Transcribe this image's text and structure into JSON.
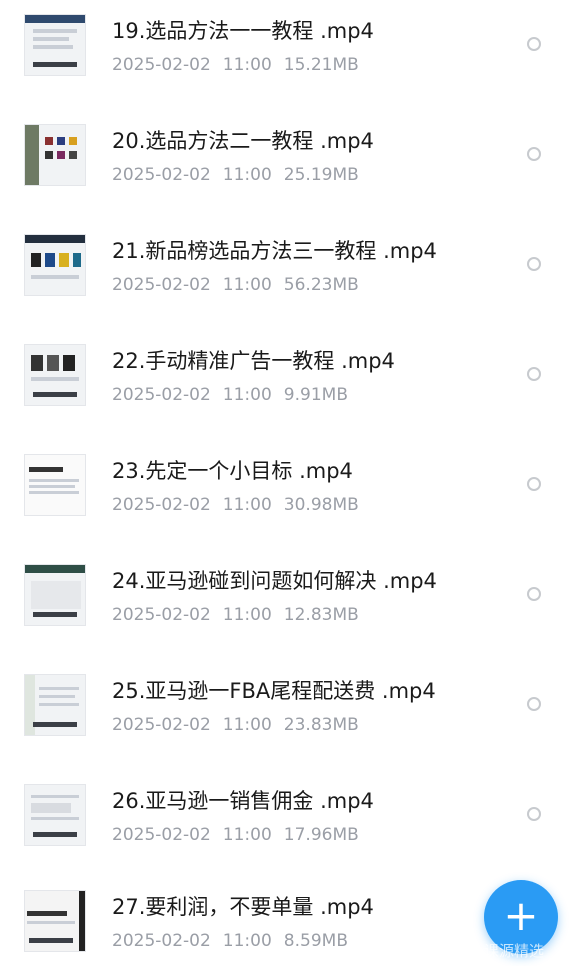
{
  "colors": {
    "accent": "#2a9bf4",
    "title_text": "#1a1a1a",
    "meta_text": "#9a9ea6"
  },
  "files": [
    {
      "name": "19.选品方法一一教程 .mp4",
      "date": "2025-02-02",
      "time": "11:00",
      "size": "15.21MB"
    },
    {
      "name": "20.选品方法二一教程 .mp4",
      "date": "2025-02-02",
      "time": "11:00",
      "size": "25.19MB"
    },
    {
      "name": "21.新品榜选品方法三一教程 .mp4",
      "date": "2025-02-02",
      "time": "11:00",
      "size": "56.23MB"
    },
    {
      "name": "22.手动精准广告一教程 .mp4",
      "date": "2025-02-02",
      "time": "11:00",
      "size": "9.91MB"
    },
    {
      "name": "23.先定一个小目标 .mp4",
      "date": "2025-02-02",
      "time": "11:00",
      "size": "30.98MB"
    },
    {
      "name": "24.亚马逊碰到问题如何解决 .mp4",
      "date": "2025-02-02",
      "time": "11:00",
      "size": "12.83MB"
    },
    {
      "name": "25.亚马逊一FBA尾程配送费 .mp4",
      "date": "2025-02-02",
      "time": "11:00",
      "size": "23.83MB"
    },
    {
      "name": "26.亚马逊一销售佣金 .mp4",
      "date": "2025-02-02",
      "time": "11:00",
      "size": "17.96MB"
    },
    {
      "name": "27.要利润，不要单量 .mp4",
      "date": "2025-02-02",
      "time": "11:00",
      "size": "8.59MB"
    }
  ],
  "fab": {
    "icon": "plus-icon",
    "glyph": "+"
  },
  "watermark": "课源精选"
}
